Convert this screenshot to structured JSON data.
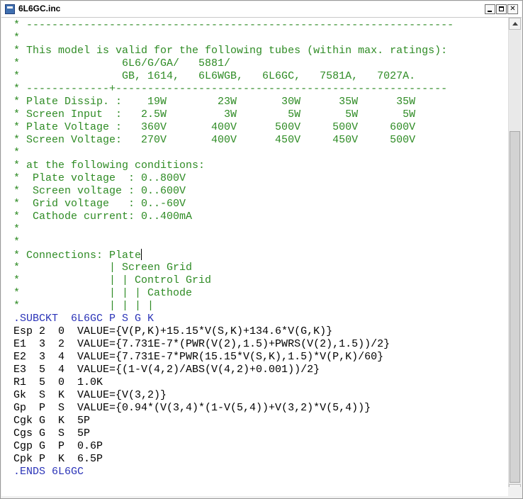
{
  "window": {
    "title": "6L6GC.inc",
    "icon": "notepad-document-icon",
    "buttons": {
      "minimize": "minimize-icon",
      "maximize": "maximize-icon",
      "close": "close-icon"
    }
  },
  "colors": {
    "comment": "#2e8b24",
    "directive": "#2b34b8",
    "plain": "#000000"
  },
  "editor": {
    "lines": [
      {
        "kind": "comment",
        "text": "* -------------------------------------------------------------------"
      },
      {
        "kind": "comment",
        "text": "*"
      },
      {
        "kind": "comment",
        "text": "* This model is valid for the following tubes (within max. ratings):"
      },
      {
        "kind": "comment",
        "text": "*                6L6/G/GA/   5881/"
      },
      {
        "kind": "comment",
        "text": "*                GB, 1614,   6L6WGB,   6L6GC,   7581A,   7027A."
      },
      {
        "kind": "comment",
        "text": "* -------------+----------------------------------------------------"
      },
      {
        "kind": "comment",
        "text": "* Plate Dissip. :    19W        23W       30W      35W      35W"
      },
      {
        "kind": "comment",
        "text": "* Screen Input  :   2.5W         3W        5W       5W       5W"
      },
      {
        "kind": "comment",
        "text": "* Plate Voltage :   360V       400V      500V     500V     600V"
      },
      {
        "kind": "comment",
        "text": "* Screen Voltage:   270V       400V      450V     450V     500V"
      },
      {
        "kind": "comment",
        "text": "*"
      },
      {
        "kind": "comment",
        "text": "* at the following conditions:"
      },
      {
        "kind": "comment",
        "text": "*  Plate voltage  : 0..800V"
      },
      {
        "kind": "comment",
        "text": "*  Screen voltage : 0..600V"
      },
      {
        "kind": "comment",
        "text": "*  Grid voltage   : 0..-60V"
      },
      {
        "kind": "comment",
        "text": "*  Cathode current: 0..400mA"
      },
      {
        "kind": "comment",
        "text": "*"
      },
      {
        "kind": "comment",
        "text": "*"
      },
      {
        "kind": "comment",
        "text": "* Connections: Plate",
        "caret": true
      },
      {
        "kind": "comment",
        "text": "*              | Screen Grid"
      },
      {
        "kind": "comment",
        "text": "*              | | Control Grid"
      },
      {
        "kind": "comment",
        "text": "*              | | | Cathode"
      },
      {
        "kind": "comment",
        "text": "*              | | | |"
      },
      {
        "kind": "directive",
        "text": ".SUBCKT  6L6GC P S G K"
      },
      {
        "kind": "plain",
        "text": "Esp 2  0  VALUE={V(P,K)+15.15*V(S,K)+134.6*V(G,K)}"
      },
      {
        "kind": "plain",
        "text": "E1  3  2  VALUE={7.731E-7*(PWR(V(2),1.5)+PWRS(V(2),1.5))/2}"
      },
      {
        "kind": "plain",
        "text": "E2  3  4  VALUE={7.731E-7*PWR(15.15*V(S,K),1.5)*V(P,K)/60}"
      },
      {
        "kind": "plain",
        "text": "E3  5  4  VALUE={(1-V(4,2)/ABS(V(4,2)+0.001))/2}"
      },
      {
        "kind": "plain",
        "text": "R1  5  0  1.0K"
      },
      {
        "kind": "plain",
        "text": "Gk  S  K  VALUE={V(3,2)}"
      },
      {
        "kind": "plain",
        "text": "Gp  P  S  VALUE={0.94*(V(3,4)*(1-V(5,4))+V(3,2)*V(5,4))}"
      },
      {
        "kind": "plain",
        "text": "Cgk G  K  5P"
      },
      {
        "kind": "plain",
        "text": "Cgs G  S  5P"
      },
      {
        "kind": "plain",
        "text": "Cgp G  P  0.6P"
      },
      {
        "kind": "plain",
        "text": "Cpk P  K  6.5P"
      },
      {
        "kind": "directive",
        "text": ".ENDS 6L6GC"
      }
    ]
  },
  "scrollbar": {
    "up": "scroll-up-arrow-icon",
    "down": "scroll-down-arrow-icon"
  }
}
